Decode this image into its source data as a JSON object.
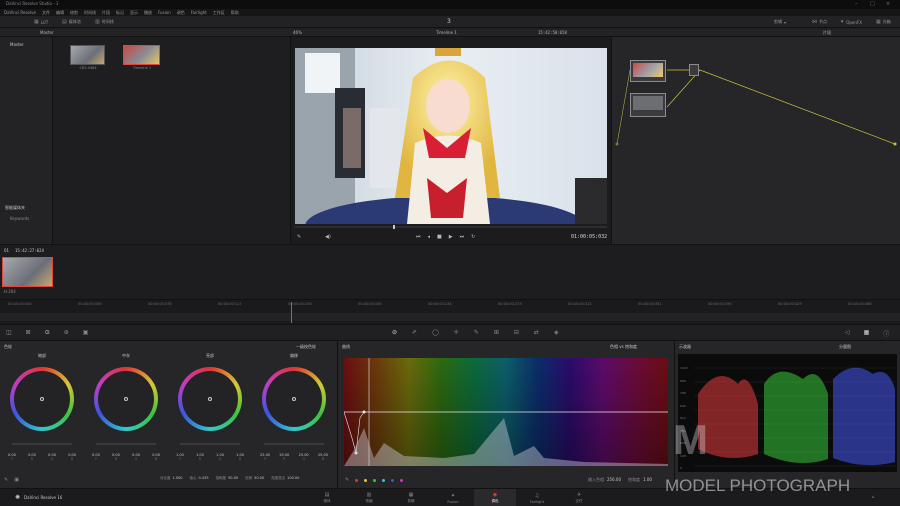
{
  "app": {
    "title_bar": "DaVinci Resolve Studio - 3",
    "menu": [
      "DaVinci Resolve",
      "文件",
      "编辑",
      "修剪",
      "时间线",
      "片段",
      "标记",
      "显示",
      "播放",
      "Fusion",
      "调色",
      "Fairlight",
      "工作区",
      "帮助"
    ],
    "project_name": "3"
  },
  "top_toolbar": {
    "lut_label": "LUT",
    "media_pool_label": "媒体池",
    "timeline_label": "时间线",
    "clips_label": "剪辑",
    "nodes_label": "节点",
    "openfx_label": "OpenFX",
    "lightbox_label": "光箱"
  },
  "viewer_bar": {
    "bin_name": "Master",
    "zoom": "46%",
    "timeline_name": "Timeline 1",
    "timecode_top": "15:42:50:658",
    "node_mode": "片段",
    "timecode_bottom": "01:00:05:032"
  },
  "media_pool": {
    "bin_label": "Master",
    "clips": [
      {
        "name": "CR2.0484"
      },
      {
        "name": "Timeline 1"
      }
    ],
    "smart_bins_label": "智能媒体夹",
    "keywords_label": "Keywords"
  },
  "clip_strip": {
    "clip_timecode": "15:42:27:024",
    "clip_number": "01",
    "clip_format": "H.264"
  },
  "ruler": {
    "ticks": [
      "00:00:00:000",
      "00:00:00:039",
      "00:00:00:078",
      "00:00:00:117",
      "00:00:00:156",
      "00:00:00:195",
      "00:00:00:234",
      "00:00:00:273",
      "00:00:00:312",
      "00:00:00:351",
      "00:00:00:390",
      "00:00:00:429",
      "00:00:00:468"
    ]
  },
  "color_wheels": {
    "section_label": "色轮",
    "mode_label": "一级校色轮",
    "wheels": [
      {
        "name": "暗部",
        "values": [
          "0.00",
          "0.00",
          "0.00",
          "0.00"
        ]
      },
      {
        "name": "中灰",
        "values": [
          "0.00",
          "0.00",
          "0.00",
          "0.00"
        ]
      },
      {
        "name": "亮部",
        "values": [
          "1.00",
          "1.00",
          "1.00",
          "1.00"
        ]
      },
      {
        "name": "偏移",
        "values": [
          "25.00",
          "25.00",
          "25.00",
          "25.00"
        ]
      }
    ],
    "channel_labels": [
      "Y",
      "R",
      "G",
      "B"
    ],
    "bottom_params": [
      {
        "label": "对比度",
        "value": "1.000"
      },
      {
        "label": "轴心",
        "value": "0.435"
      },
      {
        "label": "饱和度",
        "value": "50.00"
      },
      {
        "label": "色相",
        "value": "50.00"
      },
      {
        "label": "亮度混合",
        "value": "100.00"
      }
    ]
  },
  "curves": {
    "section_label": "曲线",
    "mode_label": "色相 vs 饱和度",
    "input_label": "输入色相",
    "input_value": "256.00",
    "sat_label": "饱和度",
    "sat_value": "1.00"
  },
  "scopes": {
    "section_label": "示波器",
    "mode_label": "分量图",
    "y_ticks": [
      "1023",
      "896",
      "768",
      "640",
      "512",
      "384",
      "256",
      "128",
      "0"
    ]
  },
  "pages": [
    {
      "label": "媒体"
    },
    {
      "label": "快编"
    },
    {
      "label": "剪辑"
    },
    {
      "label": "Fusion"
    },
    {
      "label": "调色"
    },
    {
      "label": "Fairlight"
    },
    {
      "label": "交付"
    }
  ],
  "brand": {
    "product": "DaVinci Resolve 16",
    "watermark": "MODEL PHOTOGRAPH"
  },
  "colors": {
    "accent": "#e6453c",
    "active_page": "#2a2a2d"
  }
}
